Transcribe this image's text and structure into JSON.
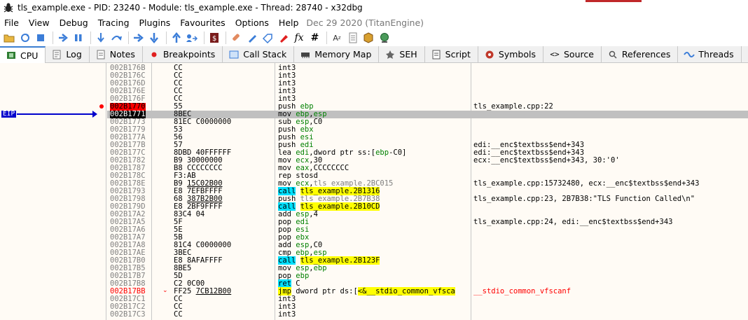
{
  "title": "tls_example.exe - PID: 23240 - Module: tls_example.exe - Thread: 28740 - x32dbg",
  "menu": [
    "File",
    "View",
    "Debug",
    "Tracing",
    "Plugins",
    "Favourites",
    "Options",
    "Help"
  ],
  "build_date": "Dec 29 2020 (TitanEngine)",
  "tabs": [
    {
      "label": "CPU",
      "icon": "cpu-icon",
      "active": true
    },
    {
      "label": "Log",
      "icon": "log-icon"
    },
    {
      "label": "Notes",
      "icon": "notes-icon"
    },
    {
      "label": "Breakpoints",
      "icon": "breakpoint-icon"
    },
    {
      "label": "Call Stack",
      "icon": "callstack-icon"
    },
    {
      "label": "Memory Map",
      "icon": "memory-map-icon"
    },
    {
      "label": "SEH",
      "icon": "seh-icon"
    },
    {
      "label": "Script",
      "icon": "script-icon"
    },
    {
      "label": "Symbols",
      "icon": "symbols-icon"
    },
    {
      "label": "Source",
      "icon": "source-icon"
    },
    {
      "label": "References",
      "icon": "references-icon"
    },
    {
      "label": "Threads",
      "icon": "threads-icon"
    }
  ],
  "eip_label": "EIP",
  "rows": [
    {
      "addr": "002B176B",
      "bytes": "CC",
      "asm": "int3",
      "comment": ""
    },
    {
      "addr": "002B176C",
      "bytes": "CC",
      "asm": "int3",
      "comment": ""
    },
    {
      "addr": "002B176D",
      "bytes": "CC",
      "asm": "int3",
      "comment": ""
    },
    {
      "addr": "002B176E",
      "bytes": "CC",
      "asm": "int3",
      "comment": ""
    },
    {
      "addr": "002B176F",
      "bytes": "CC",
      "asm": "int3",
      "comment": ""
    },
    {
      "addr": "002B1770",
      "bytes": "55",
      "asm": "push ebp",
      "comment": "tls_example.cpp:22"
    },
    {
      "addr": "002B1771",
      "bytes": "8BEC",
      "asm": "mov ebp,esp",
      "comment": ""
    },
    {
      "addr": "002B1773",
      "bytes": "81EC C0000000",
      "asm": "sub esp,C0",
      "comment": ""
    },
    {
      "addr": "002B1779",
      "bytes": "53",
      "asm": "push ebx",
      "comment": ""
    },
    {
      "addr": "002B177A",
      "bytes": "56",
      "asm": "push esi",
      "comment": ""
    },
    {
      "addr": "002B177B",
      "bytes": "57",
      "asm": "push edi",
      "comment": "edi:__enc$textbss$end+343"
    },
    {
      "addr": "002B177C",
      "bytes": "8DBD 40FFFFFF",
      "asm": "lea edi,dword ptr ss:[ebp-C0]",
      "comment": "edi:__enc$textbss$end+343"
    },
    {
      "addr": "002B1782",
      "bytes": "B9 30000000",
      "asm": "mov ecx,30",
      "comment": "ecx:__enc$textbss$end+343, 30:'0'"
    },
    {
      "addr": "002B1787",
      "bytes": "B8 CCCCCCCC",
      "asm": "mov eax,CCCCCCCC",
      "comment": ""
    },
    {
      "addr": "002B178C",
      "bytes": "F3:AB",
      "asm": "rep stosd",
      "comment": ""
    },
    {
      "addr": "002B178E",
      "bytes": "B9 15C02B00",
      "asm": "mov ecx,tls_example.2BC015",
      "comment": "tls_example.cpp:15732480, ecx:__enc$textbss$end+343"
    },
    {
      "addr": "002B1793",
      "bytes": "E8 7EFBFFFF",
      "asm": "call tls_example.2B1316",
      "comment": ""
    },
    {
      "addr": "002B1798",
      "bytes": "68 387B2B00",
      "asm": "push tls_example.2B7B38",
      "comment": "tls_example.cpp:23, 2B7B38:\"TLS Function Called\\n\""
    },
    {
      "addr": "002B179D",
      "bytes": "E8 2BF9FFFF",
      "asm": "call tls_example.2B10CD",
      "comment": ""
    },
    {
      "addr": "002B17A2",
      "bytes": "83C4 04",
      "asm": "add esp,4",
      "comment": ""
    },
    {
      "addr": "002B17A5",
      "bytes": "5F",
      "asm": "pop edi",
      "comment": "tls_example.cpp:24, edi:__enc$textbss$end+343"
    },
    {
      "addr": "002B17A6",
      "bytes": "5E",
      "asm": "pop esi",
      "comment": ""
    },
    {
      "addr": "002B17A7",
      "bytes": "5B",
      "asm": "pop ebx",
      "comment": ""
    },
    {
      "addr": "002B17A8",
      "bytes": "81C4 C0000000",
      "asm": "add esp,C0",
      "comment": ""
    },
    {
      "addr": "002B17AE",
      "bytes": "3BEC",
      "asm": "cmp ebp,esp",
      "comment": ""
    },
    {
      "addr": "002B17B0",
      "bytes": "E8 8AFAFFFF",
      "asm": "call tls_example.2B123F",
      "comment": ""
    },
    {
      "addr": "002B17B5",
      "bytes": "8BE5",
      "asm": "mov esp,ebp",
      "comment": ""
    },
    {
      "addr": "002B17B7",
      "bytes": "5D",
      "asm": "pop ebp",
      "comment": ""
    },
    {
      "addr": "002B17B8",
      "bytes": "C2 0C00",
      "asm": "ret C",
      "comment": ""
    },
    {
      "addr": "002B17BB",
      "bytes": "FF25 7CB12B00",
      "asm": "jmp dword ptr ds:[<&__stdio_common_vfsca",
      "comment": "__stdio_common_vfscanf"
    },
    {
      "addr": "002B17C1",
      "bytes": "CC",
      "asm": "int3",
      "comment": ""
    },
    {
      "addr": "002B17C2",
      "bytes": "CC",
      "asm": "int3",
      "comment": ""
    },
    {
      "addr": "002B17C3",
      "bytes": "CC",
      "asm": "int3",
      "comment": ""
    }
  ]
}
